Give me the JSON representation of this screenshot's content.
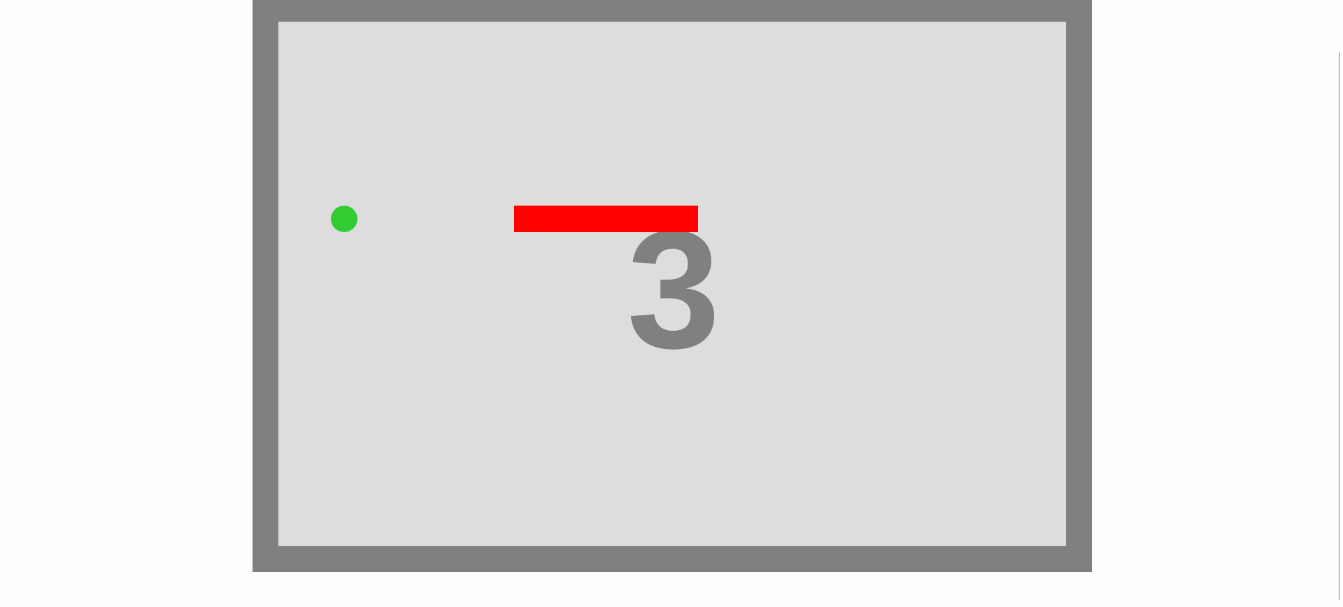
{
  "game": {
    "countdown": "3",
    "ball": {
      "color": "#33cc33",
      "name": "ball"
    },
    "paddle": {
      "color": "#ff0000",
      "name": "paddle"
    },
    "colors": {
      "frame": "#808080",
      "board": "#dddddd",
      "countdown": "#808080",
      "page_background": "#fdfdfd"
    }
  }
}
